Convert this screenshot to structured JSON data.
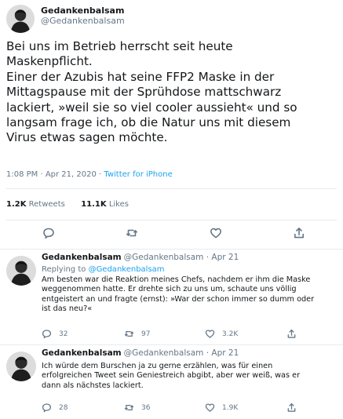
{
  "main_tweet": {
    "author_name": "Gedankenbalsam",
    "author_handle": "@Gedankenbalsam",
    "text_lines": [
      "Bei uns im Betrieb herrscht seit heute",
      "Maskenpflicht.",
      "Einer der Azubis hat seine FFP2 Maske in der",
      "Mittagspause mit der Sprühdose mattschwarz",
      "lackiert, »weil sie so viel cooler aussieht« und so",
      "langsam frage ich, ob die Natur uns mit diesem",
      "Virus etwas sagen möchte."
    ],
    "timestamp": "1:08 PM · Apr 21, 2020 · ",
    "source": "Twitter for iPhone",
    "retweets_count": "1.2K",
    "retweets_label": "Retweets",
    "likes_count": "11.1K",
    "likes_label": "Likes",
    "actions": [
      "reply-icon",
      "retweet-icon",
      "like-icon",
      "share-icon"
    ]
  },
  "replies": [
    {
      "author_name": "Gedankenbalsam",
      "author_handle": "@Gedankenbalsam · Apr 21",
      "replying_to_label": "Replying to ",
      "replying_to_handle": "@Gedankenbalsam",
      "text_lines": [
        "Am besten war die Reaktion meines Chefs, nachdem er ihm die Maske",
        "weggenommen hatte. Er drehte sich zu uns um, schaute uns völlig",
        "entgeistert an und fragte (ernst): »War der schon immer so dumm oder",
        "ist das neu?«"
      ],
      "reply_count": "32",
      "retweet_count": "97",
      "like_count": "3.2K"
    },
    {
      "author_name": "Gedankenbalsam",
      "author_handle": "@Gedankenbalsam · Apr 21",
      "text_lines": [
        "Ich würde dem Burschen ja zu gerne erzählen, was für einen",
        "erfolgreichen Tweet sein Geniestreich abgibt, aber wer weiß, was er",
        "dann als nächstes lackiert."
      ],
      "reply_count": "28",
      "retweet_count": "36",
      "like_count": "1.9K"
    }
  ],
  "colors": {
    "text": "#14171a",
    "secondary": "#657786",
    "link": "#1da1f2",
    "divider": "#e6ecf0"
  }
}
